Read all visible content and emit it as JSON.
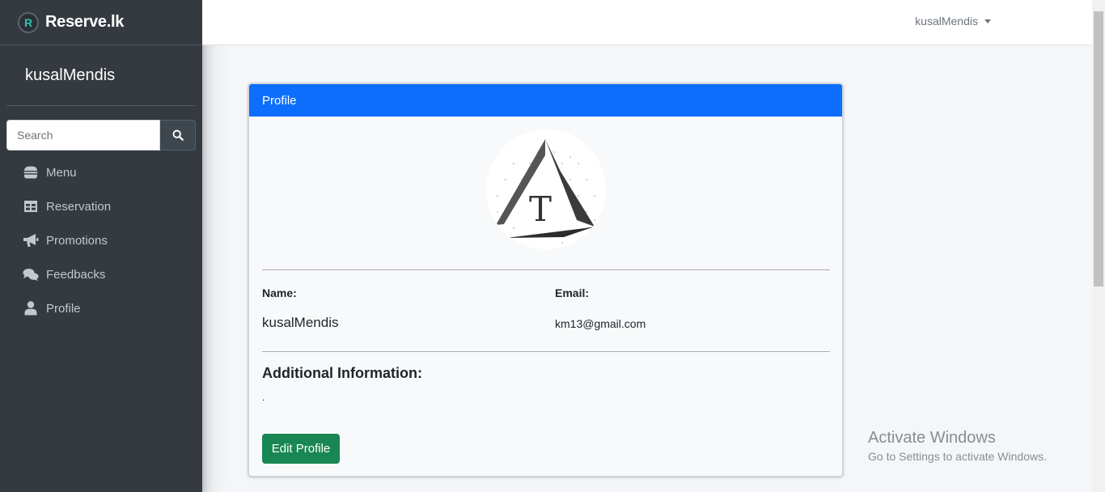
{
  "brand": {
    "logo_letter": "R",
    "name": "Reserve.lk"
  },
  "sidebar": {
    "user_name": "kusalMendis",
    "search_placeholder": "Search",
    "items": [
      {
        "label": "Menu",
        "icon": "hamburger-icon"
      },
      {
        "label": "Reservation",
        "icon": "table-icon"
      },
      {
        "label": "Promotions",
        "icon": "bullhorn-icon"
      },
      {
        "label": "Feedbacks",
        "icon": "comments-icon"
      },
      {
        "label": "Profile",
        "icon": "user-icon"
      }
    ]
  },
  "topbar": {
    "user_dropdown": "kusalMendis"
  },
  "card": {
    "header": "Profile",
    "name_label": "Name:",
    "name_value": "kusalMendis",
    "email_label": "Email:",
    "email_value": "km13@gmail.com",
    "additional_title": "Additional Information:",
    "additional_value": ".",
    "edit_button": "Edit Profile"
  },
  "watermark": {
    "title": "Activate Windows",
    "subtitle": "Go to Settings to activate Windows."
  },
  "colors": {
    "sidebar_bg": "#343a40",
    "card_header": "#0d6efd",
    "edit_button": "#198754"
  }
}
